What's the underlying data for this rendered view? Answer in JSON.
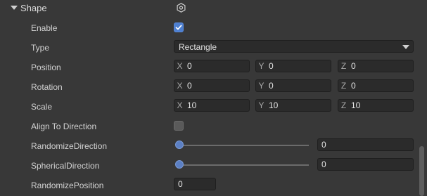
{
  "section": {
    "title": "Shape",
    "settings_icon": "gear-icon"
  },
  "rows": {
    "enable": {
      "label": "Enable",
      "checked": true
    },
    "type": {
      "label": "Type",
      "value": "Rectangle"
    },
    "position": {
      "label": "Position",
      "x_label": "X",
      "x": "0",
      "y_label": "Y",
      "y": "0",
      "z_label": "Z",
      "z": "0"
    },
    "rotation": {
      "label": "Rotation",
      "x_label": "X",
      "x": "0",
      "y_label": "Y",
      "y": "0",
      "z_label": "Z",
      "z": "0"
    },
    "scale": {
      "label": "Scale",
      "x_label": "X",
      "x": "10",
      "y_label": "Y",
      "y": "10",
      "z_label": "Z",
      "z": "10"
    },
    "align_to_direction": {
      "label": "Align To Direction",
      "checked": false
    },
    "randomize_direction": {
      "label": "RandomizeDirection",
      "value": "0",
      "slider_fraction": 0
    },
    "spherical_direction": {
      "label": "SphericalDirection",
      "value": "0",
      "slider_fraction": 0
    },
    "randomize_position": {
      "label": "RandomizePosition",
      "value": "0"
    }
  },
  "colors": {
    "background": "#383838",
    "field": "#2b2b2b",
    "accent": "#4d7fd0"
  }
}
